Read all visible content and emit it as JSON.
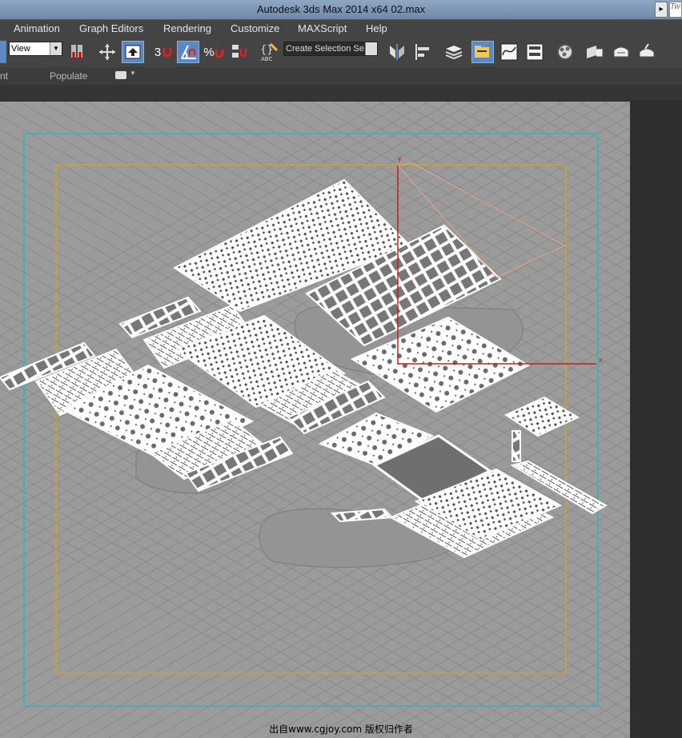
{
  "app": {
    "title": "Autodesk 3ds Max  2014 x64       02.max",
    "search_hint": "Tw"
  },
  "menu": {
    "items": [
      "Animation",
      "Graph Editors",
      "Rendering",
      "Customize",
      "MAXScript",
      "Help"
    ]
  },
  "toolbar": {
    "view_select": "View",
    "selection_set_select": "Create Selection Se",
    "snap_angle_label": "3",
    "percent_snap_label": "%"
  },
  "ribbon": {
    "left_label": "nt",
    "populate_tab": "Populate"
  },
  "viewport": {
    "axis_x": "x",
    "axis_y": "y"
  },
  "watermark": "出自www.cgjoy.com 版权归作者"
}
